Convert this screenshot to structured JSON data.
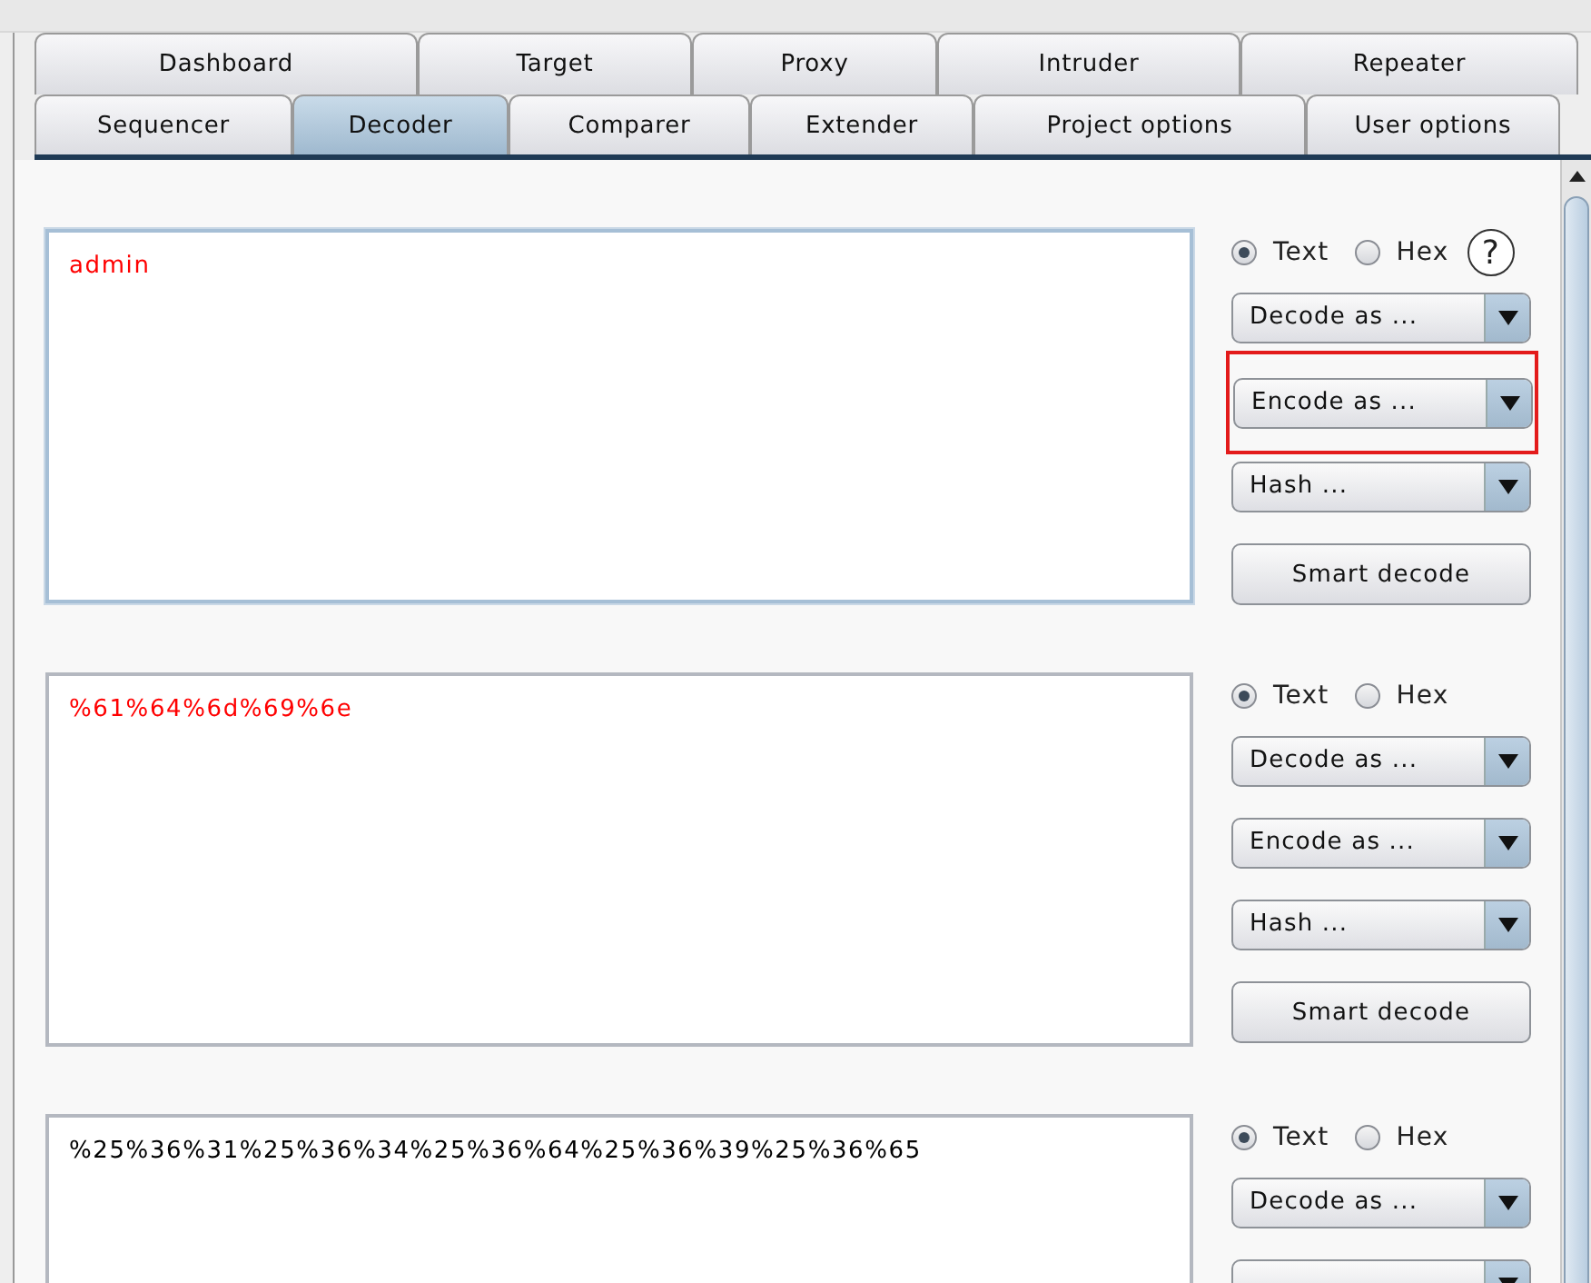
{
  "tabs": [
    [
      {
        "label": "Dashboard",
        "selected": false
      },
      {
        "label": "Target",
        "selected": false
      },
      {
        "label": "Proxy",
        "selected": false
      },
      {
        "label": "Intruder",
        "selected": false
      },
      {
        "label": "Repeater",
        "selected": false
      }
    ],
    [
      {
        "label": "Sequencer",
        "selected": false
      },
      {
        "label": "Decoder",
        "selected": true
      },
      {
        "label": "Comparer",
        "selected": false
      },
      {
        "label": "Extender",
        "selected": false
      },
      {
        "label": "Project options",
        "selected": false
      },
      {
        "label": "User options",
        "selected": false
      }
    ]
  ],
  "panels": [
    {
      "text": "admin",
      "color": "#ff0000",
      "focused": true,
      "radios": [
        {
          "label": "Text",
          "selected": true
        },
        {
          "label": "Hex",
          "selected": false
        }
      ],
      "help": "?",
      "controls": [
        {
          "kind": "dropdown",
          "label": "Decode as ...",
          "highlighted": false
        },
        {
          "kind": "dropdown",
          "label": "Encode as ...",
          "highlighted": true
        },
        {
          "kind": "dropdown",
          "label": "Hash ...",
          "highlighted": false
        },
        {
          "kind": "button",
          "label": "Smart decode"
        }
      ]
    },
    {
      "text": "%61%64%6d%69%6e",
      "color": "#ff0000",
      "focused": false,
      "radios": [
        {
          "label": "Text",
          "selected": true
        },
        {
          "label": "Hex",
          "selected": false
        }
      ],
      "controls": [
        {
          "kind": "dropdown",
          "label": "Decode as ...",
          "highlighted": false
        },
        {
          "kind": "dropdown",
          "label": "Encode as ...",
          "highlighted": false
        },
        {
          "kind": "dropdown",
          "label": "Hash ...",
          "highlighted": false
        },
        {
          "kind": "button",
          "label": "Smart decode"
        }
      ]
    },
    {
      "text": "%25%36%31%25%36%34%25%36%64%25%36%39%25%36%65",
      "color": "#000000",
      "focused": false,
      "radios": [
        {
          "label": "Text",
          "selected": true
        },
        {
          "label": "Hex",
          "selected": false
        }
      ],
      "controls": [
        {
          "kind": "dropdown",
          "label": "Decode as ...",
          "highlighted": false
        },
        {
          "kind": "dropdown",
          "highlighted": false
        }
      ]
    }
  ]
}
